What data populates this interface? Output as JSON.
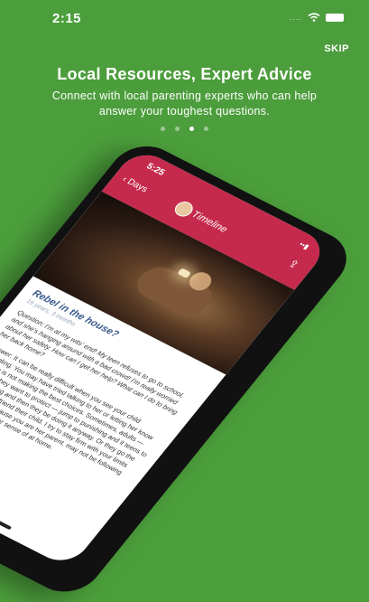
{
  "status": {
    "time": "2:15",
    "signal": "....",
    "wifi": "wifi-icon"
  },
  "skip_label": "SKIP",
  "headline": "Local Resources, Expert Advice",
  "subtext": "Connect with local parenting experts who can help answer your toughest questions.",
  "pager": {
    "count": 4,
    "active_index": 2
  },
  "phone": {
    "time": "5:25",
    "status_text": "••▮",
    "back_label": "Days",
    "title": "Timeline",
    "article": {
      "title": "Rebel in the house?",
      "meta": "16 years, 3 months",
      "question": "Question: I'm at my wits' end! My teen refuses to go to school, and she's hanging around with a bad crowd! I'm really worried about her safety. How can I get her help? What can I do to bring her back home?",
      "answer": "Answer: It can be really difficult when you see your child struggling. You may have tried talking to her or letting her know that she is not making the best choices. Sometimes, adults — because they want to protect — jump to punishing and it teens to do something and then they be doing it anyway. Or they go the other try to befriend their child. I try to stay firm with your limits and not and because you are her parent. may not be following the to help build her sense of at home."
    }
  },
  "colors": {
    "background": "#4c9e3c",
    "header": "#c52a4c",
    "title_blue": "#3a5a8c"
  }
}
